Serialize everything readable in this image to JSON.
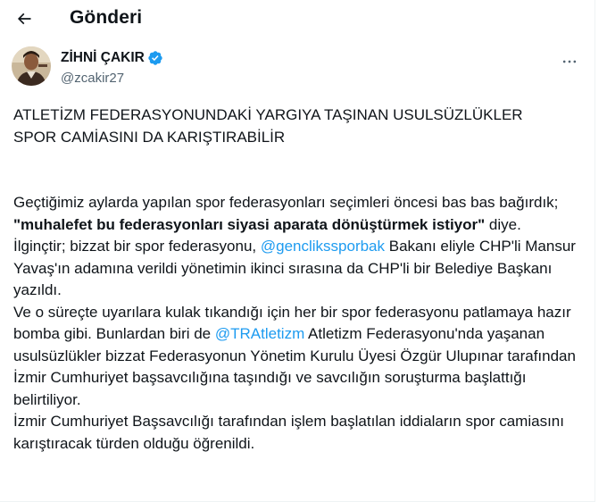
{
  "header": {
    "title": "Gönderi",
    "back_icon": "arrow-left-icon"
  },
  "author": {
    "name": "ZİHNİ ÇAKIR",
    "handle": "@zcakir27",
    "verified_icon": "verified-badge-icon",
    "verified_color": "#1d9bf0",
    "more_icon": "more-horizontal-icon"
  },
  "tweet": {
    "headline_line1": "ATLETİZM FEDERASYONUNDAKİ YARGIYA TAŞINAN USULSÜZLÜKLER",
    "headline_line2": "SPOR CAMİASINI DA KARIŞTIRABİLİR",
    "p1_a": "Geçtiğimiz aylarda yapılan spor federasyonları seçimleri öncesi bas bas bağırdık; ",
    "p1_bold": "\"muhalefet bu federasyonları siyasi aparata dönüştürmek istiyor\"",
    "p1_c": " diye.",
    "p2_a": "İlginçtir; bizzat bir spor federasyonu, ",
    "p2_mention": "@genclikssporbak",
    "p2_c": " Bakanı eliyle CHP'li Mansur Yavaş'ın adamına verildi yönetimin ikinci sırasına da CHP'li bir Belediye Başkanı yazıldı.",
    "p3_a": "Ve o süreçte uyarılara kulak tıkandığı için her bir spor federasyonu patlamaya hazır bomba gibi. Bunlardan biri de ",
    "p3_mention": "@TRAtletizm",
    "p3_c": " Atletizm Federasyonu'nda yaşanan usulsüzlükler bizzat Federasyonun Yönetim Kurulu Üyesi Özgür Ulupınar tarafından İzmir Cumhuriyet başsavcılığına taşındığı ve savcılığın soruşturma başlattığı belirtiliyor.",
    "p4": "İzmir Cumhuriyet Başsavcılığı tarafından işlem başlatılan iddiaların spor camiasını karıştıracak türden olduğu öğrenildi.",
    "mention_color": "#1d9bf0"
  }
}
